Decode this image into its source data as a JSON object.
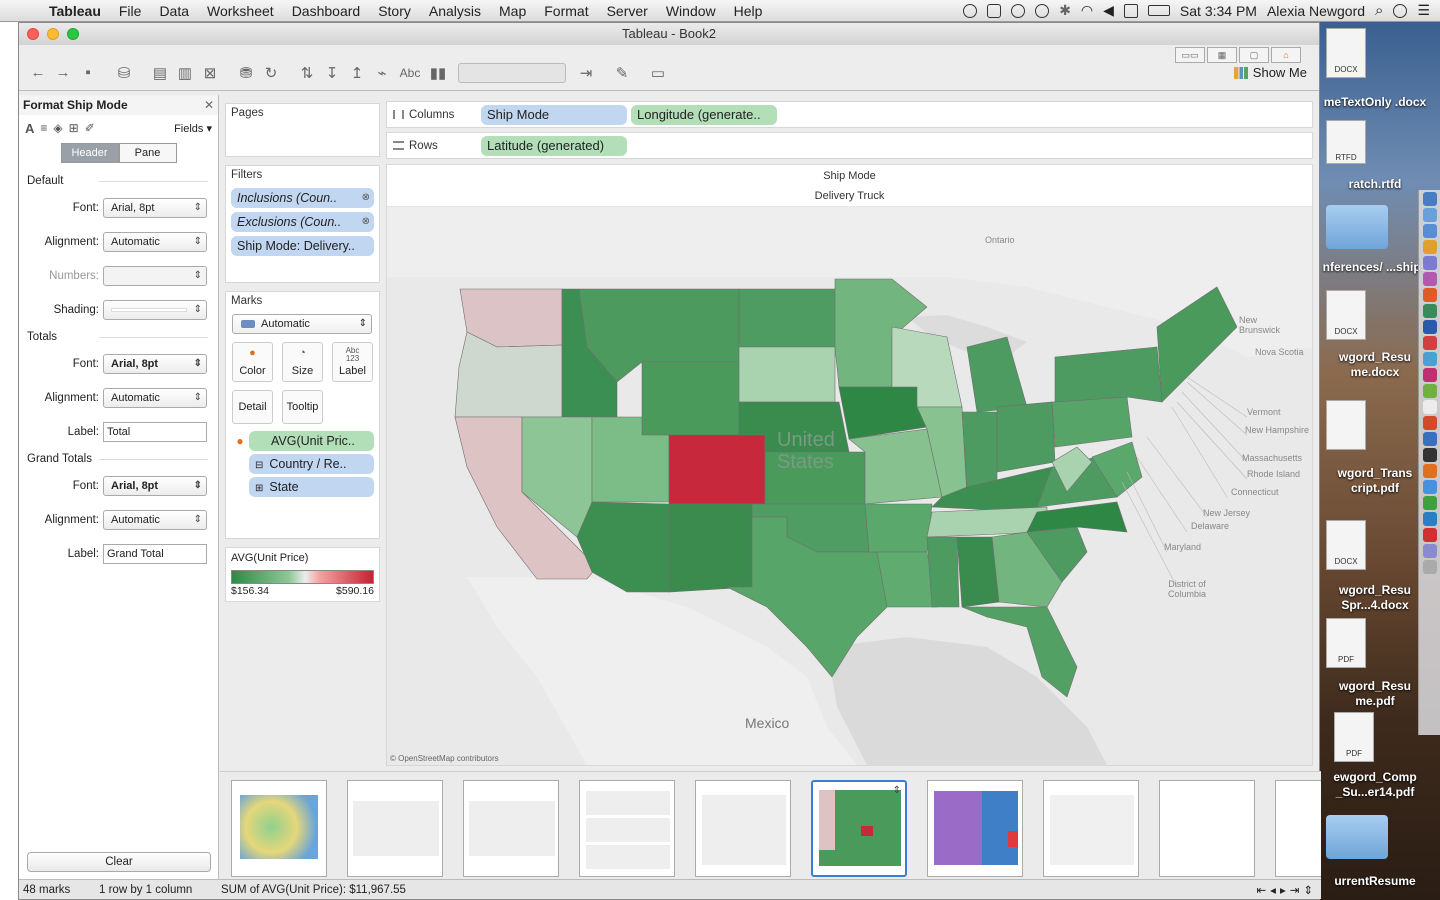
{
  "menubar": {
    "app": "Tableau",
    "items": [
      "File",
      "Data",
      "Worksheet",
      "Dashboard",
      "Story",
      "Analysis",
      "Map",
      "Format",
      "Server",
      "Window",
      "Help"
    ],
    "clock": "Sat 3:34 PM",
    "user": "Alexia Newgord"
  },
  "window": {
    "title": "Tableau - Book2"
  },
  "toolbar": {
    "show_me": "Show Me",
    "abc": "Abc"
  },
  "format_pane": {
    "title": "Format Ship Mode",
    "fields": "Fields",
    "tabs": [
      "Header",
      "Pane"
    ],
    "default_section": "Default",
    "totals_section": "Totals",
    "grand_section": "Grand Totals",
    "font_label": "Font:",
    "align_label": "Alignment:",
    "numbers_label": "Numbers:",
    "shading_label": "Shading:",
    "label_label": "Label:",
    "font_value": "Arial, 8pt",
    "align_value": "Automatic",
    "totals_label_value": "Total",
    "grand_label_value": "Grand Total",
    "clear": "Clear"
  },
  "pages": {
    "title": "Pages"
  },
  "filters": {
    "title": "Filters",
    "items": [
      "Inclusions (Coun..",
      "Exclusions (Coun..",
      "Ship Mode: Delivery.."
    ]
  },
  "marks": {
    "title": "Marks",
    "type": "Automatic",
    "buttons": [
      "Color",
      "Size",
      "Label",
      "Detail",
      "Tooltip"
    ],
    "label_glyph": "Abc\n123",
    "fields": [
      "AVG(Unit Pric..",
      "Country / Re..",
      "State"
    ]
  },
  "legend": {
    "title": "AVG(Unit Price)",
    "min": "$156.34",
    "max": "$590.16"
  },
  "columns": {
    "label": "Columns",
    "pills": [
      "Ship Mode",
      "Longitude (generate.."
    ]
  },
  "rows": {
    "label": "Rows",
    "pills": [
      "Latitude (generated)"
    ]
  },
  "view": {
    "header1": "Ship Mode",
    "header2": "Delivery Truck",
    "map_labels": {
      "ontario": "Ontario",
      "us1": "United",
      "us2": "States",
      "mexico": "Mexico",
      "nb": "New Brunswick",
      "ns": "Nova Scotia",
      "vt": "Vermont",
      "nh": "New Hampshire",
      "ma": "Massachusetts",
      "ri": "Rhode Island",
      "ct": "Connecticut",
      "nj": "New Jersey",
      "de": "Delaware",
      "md": "Maryland",
      "dc": "District of Columbia"
    },
    "copyright": "© OpenStreetMap contributors"
  },
  "status": {
    "marks": "48 marks",
    "dims": "1 row by 1 column",
    "sum": "SUM of AVG(Unit Price): $11,967.55"
  },
  "desktop": {
    "files": [
      "meTextOnly .docx",
      "ratch.rtfd",
      "nferences/ ...ships",
      "wgord_Resu me.docx",
      "wgord_Trans cript.pdf",
      "wgord_Resu Spr...4.docx",
      "wgord_Resu me.pdf",
      "ewgord_Comp _Su...er14.pdf",
      "urrentResume"
    ],
    "tags": [
      "DOCX",
      "RTFD",
      "DOCX",
      "DOCX",
      "PDF",
      "PDF"
    ]
  },
  "colors": {
    "accent": "#3b7fd4",
    "pill_blue": "#c1d6f0",
    "pill_green": "#b3dfb8",
    "high": "#c8202f",
    "low": "#2f8a45"
  }
}
